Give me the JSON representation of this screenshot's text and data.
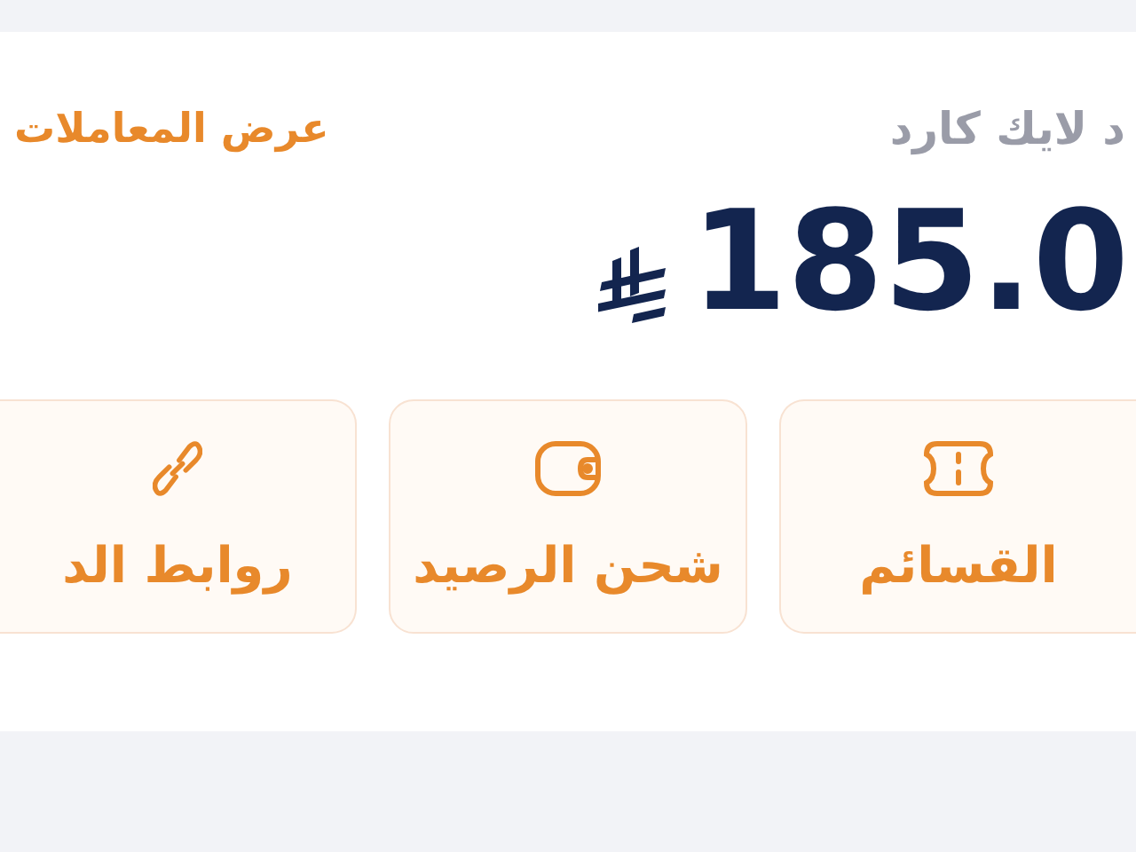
{
  "card": {
    "title": "د لايك كارد",
    "link": "عرض المعاملات",
    "balance": "185.0"
  },
  "actions": [
    {
      "kind": "ticket",
      "label": "القسائم"
    },
    {
      "kind": "wallet",
      "label": "شحن الرصيد"
    },
    {
      "kind": "link",
      "label": "روابط الد"
    }
  ]
}
